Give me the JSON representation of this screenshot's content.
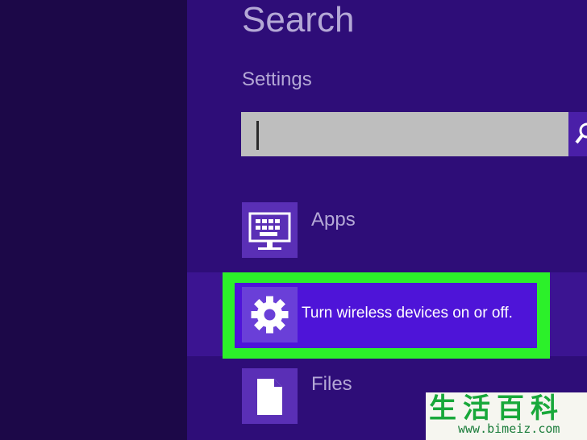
{
  "search": {
    "title": "Search",
    "scope": "Settings",
    "query": "",
    "placeholder": ""
  },
  "results": [
    {
      "label": "Apps",
      "icon": "keyboard-monitor-icon"
    },
    {
      "label": "Turn wireless devices on or off.",
      "icon": "gear-icon",
      "highlighted": true
    },
    {
      "label": "Files",
      "icon": "document-icon"
    }
  ],
  "watermark": {
    "chars": "生活百科",
    "url": "www.bimeiz.com"
  },
  "colors": {
    "background": "#1c0848",
    "pane": "#2e0d78",
    "highlight_border": "#2cf02a",
    "highlight_fill": "#4e14d8",
    "text_muted": "#b4a8d6"
  }
}
